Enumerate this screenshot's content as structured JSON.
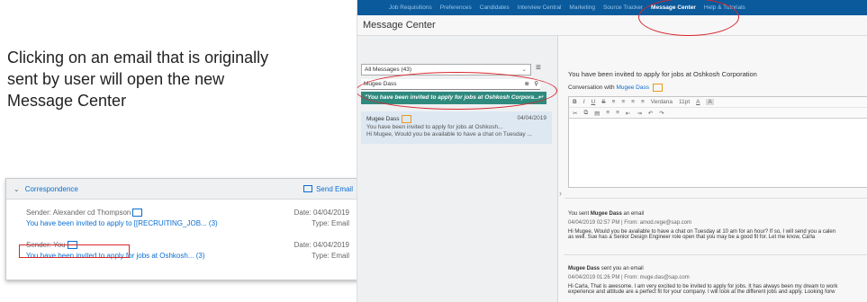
{
  "intro": {
    "line1": "Clicking on an email that is originally",
    "line2": "sent by user will open the new",
    "line3": "Message Center"
  },
  "correspondence": {
    "title": "Correspondence",
    "send_email": "Send Email",
    "rows": [
      {
        "sender": "Sender: Alexander cd Thompson",
        "subject": "You have been invited to apply to [[RECRUITING_JOB... (3)",
        "date": "Date: 04/04/2019",
        "type": "Type: Email"
      },
      {
        "sender": "Sender: You",
        "subject": "You have been invited to apply for jobs at Oshkosh... (3)",
        "date": "Date: 04/04/2019",
        "type": "Type: Email"
      }
    ]
  },
  "nav": {
    "items": [
      "Job Requisitions",
      "Preferences",
      "Candidates",
      "Interview Central",
      "Marketing",
      "Source Tracker",
      "Message Center",
      "Help & Tutorials"
    ],
    "active": "Message Center"
  },
  "message_center": {
    "title": "Message Center",
    "filter": "All Messages (43)",
    "search_value": "Mugee Dass",
    "suggestion": "\"You have been invited to apply for jobs at Oshkosh Corpora...",
    "list_item": {
      "from": "Mugee Dass",
      "date": "04/04/2019",
      "line1": "You have been invited to apply for jobs at Oshkosh...",
      "line2": "Hi Mugee, Would you be available to have a chat on Tuesday ..."
    },
    "subject": "You have been invited to apply for jobs at Oshkosh Corporation",
    "conversation_prefix": "Conversation with",
    "conversation_with": "Mugee Dass",
    "toolbar": {
      "font": "Verdana",
      "size": "11pt",
      "text_color": "A",
      "bg_color": "A"
    },
    "messages": [
      {
        "head_pre": "You sent",
        "head_name": "Mugee Dass",
        "head_post": "an email",
        "meta": "04/04/2019 02:57 PM  | From: amod.rege@sap.com",
        "body1": "Hi Mugee, Would you be available to have a chat on Tuesday at 10 am for an hour?  If so, I will send you a calen",
        "body2": "as well.  Sue has a Senior Design Engineer role open that you may be a good fit for. Let me know, Carla"
      },
      {
        "head_pre": "",
        "head_name": "Mugee Dass",
        "head_post": "sent you an email",
        "meta": "04/04/2019 01:26 PM  | From: muge.das@sap.com",
        "body1": "Hi Carla, That is awesome. I am very excited to be invited to apply for jobs. It has always been my dream to work",
        "body2": "experience and attitude are a perfect fit for your company. I will look at the different jobs and apply. Looking forw"
      }
    ]
  },
  "colors": {
    "accent": "#0a6ed1",
    "nav_bg": "#0a5a9c",
    "highlight": "#d9262c",
    "suggest_bg": "#2f8a7e",
    "arrow": "#f0a31c"
  }
}
